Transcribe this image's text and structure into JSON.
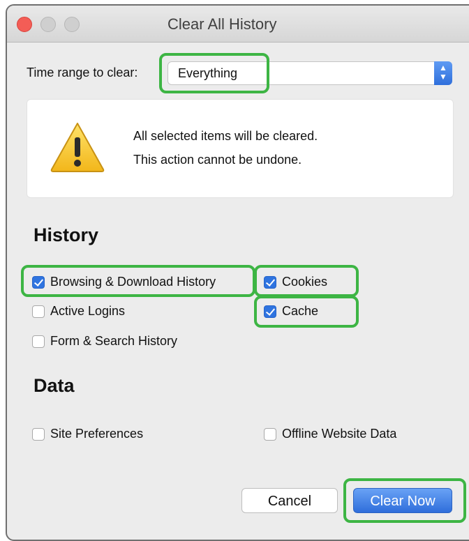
{
  "window": {
    "title": "Clear All History"
  },
  "time_range": {
    "label": "Time range to clear:",
    "selected": "Everything"
  },
  "warning": {
    "line1": "All selected items will be cleared.",
    "line2": "This action cannot be undone."
  },
  "history": {
    "heading": "History",
    "items": [
      {
        "label": "Browsing & Download History",
        "checked": true
      },
      {
        "label": "Cookies",
        "checked": true
      },
      {
        "label": "Active Logins",
        "checked": false
      },
      {
        "label": "Cache",
        "checked": true
      },
      {
        "label": "Form & Search History",
        "checked": false
      }
    ]
  },
  "data_section": {
    "heading": "Data",
    "items": [
      {
        "label": "Site Preferences",
        "checked": false
      },
      {
        "label": "Offline Website Data",
        "checked": false
      }
    ]
  },
  "buttons": {
    "cancel": "Cancel",
    "clear_now": "Clear Now"
  },
  "colors": {
    "highlight": "#3db544",
    "accent": "#2f74e0"
  }
}
